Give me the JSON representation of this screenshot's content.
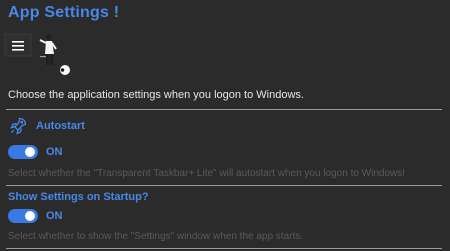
{
  "app": {
    "title": "App Settings !"
  },
  "header": {
    "illustration_icon": "person-presenting-menu-illustration",
    "description": "Choose the application settings when you logon to Windows."
  },
  "settings": {
    "autostart": {
      "icon": "rocket-icon",
      "label": "Autostart",
      "toggle_state": "ON",
      "help": "Select whether the \"Transparent Taskbar+ Lite\" will autostart when you logon to Windows!"
    },
    "show_settings": {
      "label": "Show Settings on Startup?",
      "toggle_state": "ON",
      "help": "Select whether to show the \"Settings\" window when the app starts."
    }
  },
  "colors": {
    "background": "#2b2b2b",
    "accent": "#4a86e8",
    "toggle_on": "#3a78e6",
    "divider": "#9a9a9a",
    "helper_text": "#5b5b5b"
  }
}
